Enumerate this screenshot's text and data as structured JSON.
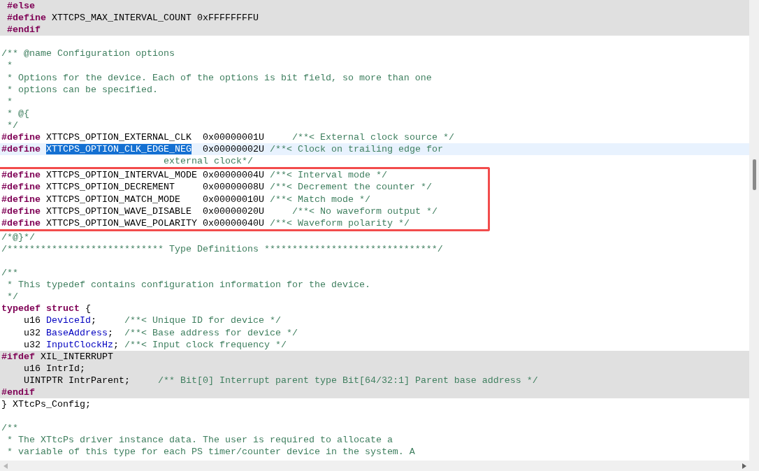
{
  "blocks": [
    {
      "kind": "inactive",
      "lines": [
        {
          "kind": "code",
          "segments": [
            {
              "kind": "directive",
              "text": " #else"
            }
          ]
        },
        {
          "kind": "code",
          "segments": [
            {
              "kind": "directive",
              "text": " #define"
            },
            {
              "kind": "code",
              "text": " XTTCPS_MAX_INTERVAL_COUNT 0xFFFFFFFFU"
            }
          ]
        },
        {
          "kind": "code",
          "segments": [
            {
              "kind": "directive",
              "text": " #endif"
            }
          ]
        }
      ]
    },
    {
      "kind": "plain",
      "lines": [
        {
          "kind": "blank"
        },
        {
          "kind": "code",
          "segments": [
            {
              "kind": "comment",
              "text": "/** @name Configuration options"
            }
          ]
        },
        {
          "kind": "code",
          "segments": [
            {
              "kind": "comment",
              "text": " *"
            }
          ]
        },
        {
          "kind": "code",
          "segments": [
            {
              "kind": "comment",
              "text": " * Options for the device. Each of the options is bit field, so more than one"
            }
          ]
        },
        {
          "kind": "code",
          "segments": [
            {
              "kind": "comment",
              "text": " * options can be specified."
            }
          ]
        },
        {
          "kind": "code",
          "segments": [
            {
              "kind": "comment",
              "text": " *"
            }
          ]
        },
        {
          "kind": "code",
          "segments": [
            {
              "kind": "comment",
              "text": " * @{"
            }
          ]
        },
        {
          "kind": "code",
          "segments": [
            {
              "kind": "comment",
              "text": " */"
            }
          ]
        },
        {
          "kind": "code",
          "segments": [
            {
              "kind": "directive",
              "text": "#define"
            },
            {
              "kind": "code",
              "text": " XTTCPS_OPTION_EXTERNAL_CLK  0x00000001U"
            },
            {
              "kind": "comment",
              "text": "     /**< External clock source */"
            }
          ]
        }
      ]
    },
    {
      "kind": "current",
      "lines": [
        {
          "kind": "code",
          "segments": [
            {
              "kind": "directive",
              "text": "#define"
            },
            {
              "kind": "selected",
              "text": " XTTCPS_OPTION_CLK_EDGE_NEG"
            },
            {
              "kind": "code",
              "text": "  0x00000002U"
            },
            {
              "kind": "comment",
              "text": " /**< Clock on trailing edge for"
            }
          ]
        }
      ]
    },
    {
      "kind": "plain",
      "lines": [
        {
          "kind": "code",
          "segments": [
            {
              "kind": "comment",
              "text": "                             external clock*/"
            }
          ]
        }
      ]
    },
    {
      "kind": "marked",
      "lines": [
        {
          "kind": "code",
          "segments": [
            {
              "kind": "directive",
              "text": "#define"
            },
            {
              "kind": "code",
              "text": " XTTCPS_OPTION_INTERVAL_MODE 0x00000004U"
            },
            {
              "kind": "comment",
              "text": " /**< Interval mode */"
            }
          ]
        },
        {
          "kind": "code",
          "segments": [
            {
              "kind": "directive",
              "text": "#define"
            },
            {
              "kind": "code",
              "text": " XTTCPS_OPTION_DECREMENT     0x00000008U"
            },
            {
              "kind": "comment",
              "text": " /**< Decrement the counter */"
            }
          ]
        },
        {
          "kind": "code",
          "segments": [
            {
              "kind": "directive",
              "text": "#define"
            },
            {
              "kind": "code",
              "text": " XTTCPS_OPTION_MATCH_MODE    0x00000010U"
            },
            {
              "kind": "comment",
              "text": " /**< Match mode */"
            }
          ]
        },
        {
          "kind": "code",
          "segments": [
            {
              "kind": "directive",
              "text": "#define"
            },
            {
              "kind": "code",
              "text": " XTTCPS_OPTION_WAVE_DISABLE  0x00000020U"
            },
            {
              "kind": "comment",
              "text": "     /**< No waveform output */"
            }
          ]
        },
        {
          "kind": "code",
          "segments": [
            {
              "kind": "directive",
              "text": "#define"
            },
            {
              "kind": "code",
              "text": " XTTCPS_OPTION_WAVE_POLARITY 0x00000040U"
            },
            {
              "kind": "comment",
              "text": " /**< Waveform polarity */"
            }
          ]
        }
      ]
    },
    {
      "kind": "plain",
      "lines": [
        {
          "kind": "code",
          "segments": [
            {
              "kind": "comment",
              "text": "/*@}*/"
            }
          ]
        },
        {
          "kind": "code",
          "segments": [
            {
              "kind": "comment",
              "text": "/**************************** Type Definitions *******************************/"
            }
          ]
        },
        {
          "kind": "blank"
        },
        {
          "kind": "code",
          "segments": [
            {
              "kind": "comment",
              "text": "/**"
            }
          ]
        },
        {
          "kind": "code",
          "segments": [
            {
              "kind": "comment",
              "text": " * This typedef contains configuration information for the device."
            }
          ]
        },
        {
          "kind": "code",
          "segments": [
            {
              "kind": "comment",
              "text": " */"
            }
          ]
        },
        {
          "kind": "code",
          "segments": [
            {
              "kind": "directive",
              "text": "typedef struct"
            },
            {
              "kind": "code",
              "text": " {"
            }
          ]
        },
        {
          "kind": "code",
          "segments": [
            {
              "kind": "code",
              "text": "    u16"
            },
            {
              "kind": "field",
              "text": " DeviceId"
            },
            {
              "kind": "code",
              "text": ";"
            },
            {
              "kind": "comment",
              "text": "     /**< Unique ID for device */"
            }
          ]
        },
        {
          "kind": "code",
          "segments": [
            {
              "kind": "code",
              "text": "    u32"
            },
            {
              "kind": "field",
              "text": " BaseAddress"
            },
            {
              "kind": "code",
              "text": ";"
            },
            {
              "kind": "comment",
              "text": "  /**< Base address for device */"
            }
          ]
        },
        {
          "kind": "code",
          "segments": [
            {
              "kind": "code",
              "text": "    u32"
            },
            {
              "kind": "field",
              "text": " InputClockHz"
            },
            {
              "kind": "code",
              "text": ";"
            },
            {
              "kind": "comment",
              "text": " /**< Input clock frequency */"
            }
          ]
        }
      ]
    },
    {
      "kind": "inactive",
      "lines": [
        {
          "kind": "code",
          "segments": [
            {
              "kind": "directive",
              "text": "#ifdef"
            },
            {
              "kind": "code",
              "text": " XIL_INTERRUPT"
            }
          ]
        },
        {
          "kind": "code",
          "segments": [
            {
              "kind": "code",
              "text": "    u16 IntrId;"
            }
          ]
        },
        {
          "kind": "code",
          "segments": [
            {
              "kind": "code",
              "text": "    UINTPTR IntrParent;"
            },
            {
              "kind": "comment",
              "text": "     /** Bit[0] Interrupt parent type Bit[64/32:1] Parent base address */"
            }
          ]
        },
        {
          "kind": "code",
          "segments": [
            {
              "kind": "directive",
              "text": "#endif"
            }
          ]
        }
      ]
    },
    {
      "kind": "plain",
      "lines": [
        {
          "kind": "code",
          "segments": [
            {
              "kind": "code",
              "text": "} XTtcPs_Config;"
            }
          ]
        },
        {
          "kind": "blank"
        },
        {
          "kind": "code",
          "segments": [
            {
              "kind": "comment",
              "text": "/**"
            }
          ]
        },
        {
          "kind": "code",
          "segments": [
            {
              "kind": "comment",
              "text": " * The XTtcPs driver instance data. The user is required to allocate a"
            }
          ]
        },
        {
          "kind": "code",
          "segments": [
            {
              "kind": "comment",
              "text": " * variable of this type for each PS timer/counter device in the system. A"
            }
          ]
        }
      ]
    }
  ]
}
